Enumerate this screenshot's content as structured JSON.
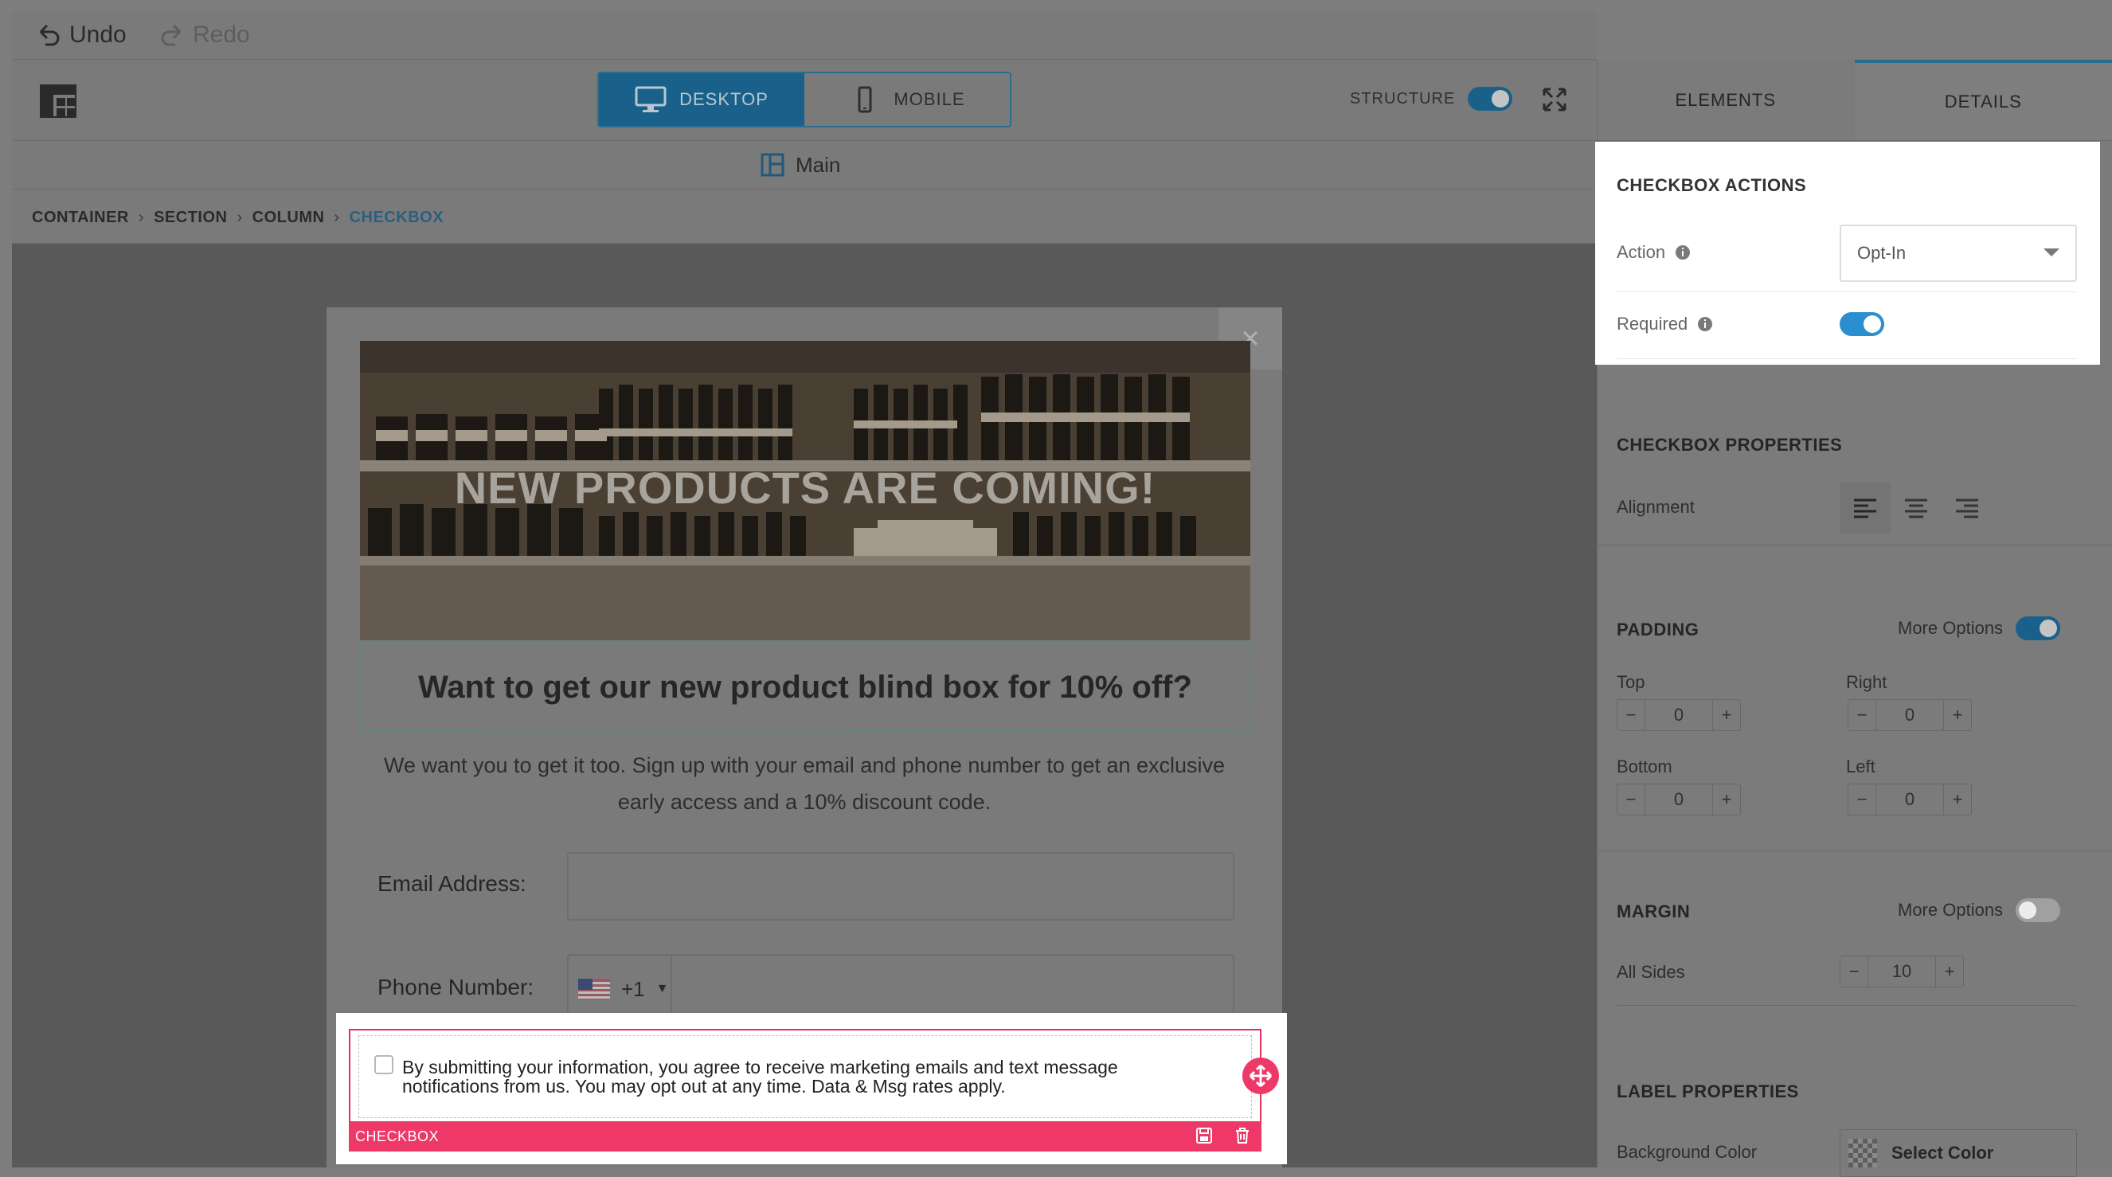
{
  "history": {
    "undo_label": "Undo",
    "redo_label": "Redo"
  },
  "view_toggle": {
    "desktop_label": "DESKTOP",
    "mobile_label": "MOBILE",
    "selected": "desktop"
  },
  "structure": {
    "label": "STRUCTURE",
    "enabled": true
  },
  "main_label": "Main",
  "breadcrumb": [
    "CONTAINER",
    "SECTION",
    "COLUMN",
    "CHECKBOX"
  ],
  "popup": {
    "hero_text": "NEW PRODUCTS ARE COMING!",
    "headline": "Want to get our new product blind box for 10% off?",
    "subtext": "We want you to get it too. Sign up with your email and phone number to get an exclusive early access and a 10% discount code.",
    "email_label": "Email Address:",
    "phone_label": "Phone Number:",
    "phone_country_code": "+1",
    "checkbox_text": "By submitting your information, you agree to receive marketing emails and text message notifications from us. You may opt out at any time. Data & Msg rates apply.",
    "selected_element_label": "CHECKBOX",
    "close_symbol": "×"
  },
  "right_panel": {
    "tabs": [
      "ELEMENTS",
      "DETAILS"
    ],
    "active_tab": "DETAILS",
    "checkbox_actions": {
      "title": "CHECKBOX ACTIONS",
      "action_label": "Action",
      "action_value": "Opt-In",
      "required_label": "Required",
      "required": true
    },
    "checkbox_properties": {
      "title": "CHECKBOX PROPERTIES",
      "alignment_label": "Alignment",
      "alignment": "left"
    },
    "padding": {
      "title": "PADDING",
      "more_options_label": "More Options",
      "more_options": true,
      "top_label": "Top",
      "top": "0",
      "right_label": "Right",
      "right": "0",
      "bottom_label": "Bottom",
      "bottom": "0",
      "left_label": "Left",
      "left": "0"
    },
    "margin": {
      "title": "MARGIN",
      "more_options_label": "More Options",
      "more_options": false,
      "all_sides_label": "All Sides",
      "all_sides": "10"
    },
    "label_properties": {
      "title": "LABEL PROPERTIES",
      "bg_label": "Background Color",
      "select_color_label": "Select Color"
    }
  },
  "colors": {
    "accent": "#19618a",
    "highlight": "#ee3868",
    "toggle_active": "#2a8ecf"
  },
  "stepper_minus": "−",
  "stepper_plus": "+"
}
